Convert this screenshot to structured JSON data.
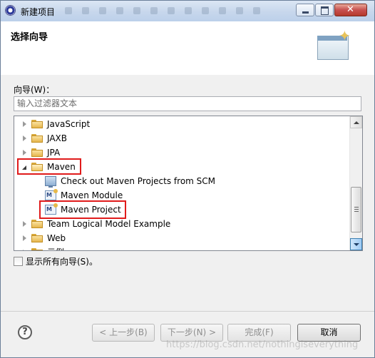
{
  "window": {
    "title": "新建项目",
    "header_title": "选择向导"
  },
  "filter": {
    "label": "向导(W)：",
    "placeholder": "输入过滤器文本"
  },
  "tree": {
    "items": [
      {
        "label": "JavaScript",
        "type": "folder",
        "state": "collapsed",
        "level": 0
      },
      {
        "label": "JAXB",
        "type": "folder",
        "state": "collapsed",
        "level": 0
      },
      {
        "label": "JPA",
        "type": "folder",
        "state": "collapsed",
        "level": 0
      },
      {
        "label": "Maven",
        "type": "folder",
        "state": "expanded",
        "level": 0,
        "highlighted": true
      },
      {
        "label": "Check out Maven Projects from SCM",
        "type": "scm-item",
        "level": 1
      },
      {
        "label": "Maven Module",
        "type": "maven-item",
        "level": 1
      },
      {
        "label": "Maven Project",
        "type": "maven-item",
        "level": 1,
        "highlighted": true
      },
      {
        "label": "Team Logical Model Example",
        "type": "folder",
        "state": "collapsed",
        "level": 0
      },
      {
        "label": "Web",
        "type": "folder",
        "state": "collapsed",
        "level": 0
      },
      {
        "label": "示例",
        "type": "folder",
        "state": "collapsed",
        "level": 0
      }
    ]
  },
  "show_all": {
    "label": "显示所有向导(S)。",
    "checked": false
  },
  "buttons": {
    "help": "?",
    "back": "< 上一步(B)",
    "next": "下一步(N) >",
    "finish": "完成(F)",
    "cancel": "取消"
  },
  "watermark": "https://blog.csdn.net/nothingiseverything",
  "colors": {
    "highlight_border": "#e01b1b",
    "titlebar": "#c7d7ec",
    "close_button": "#c75050"
  }
}
